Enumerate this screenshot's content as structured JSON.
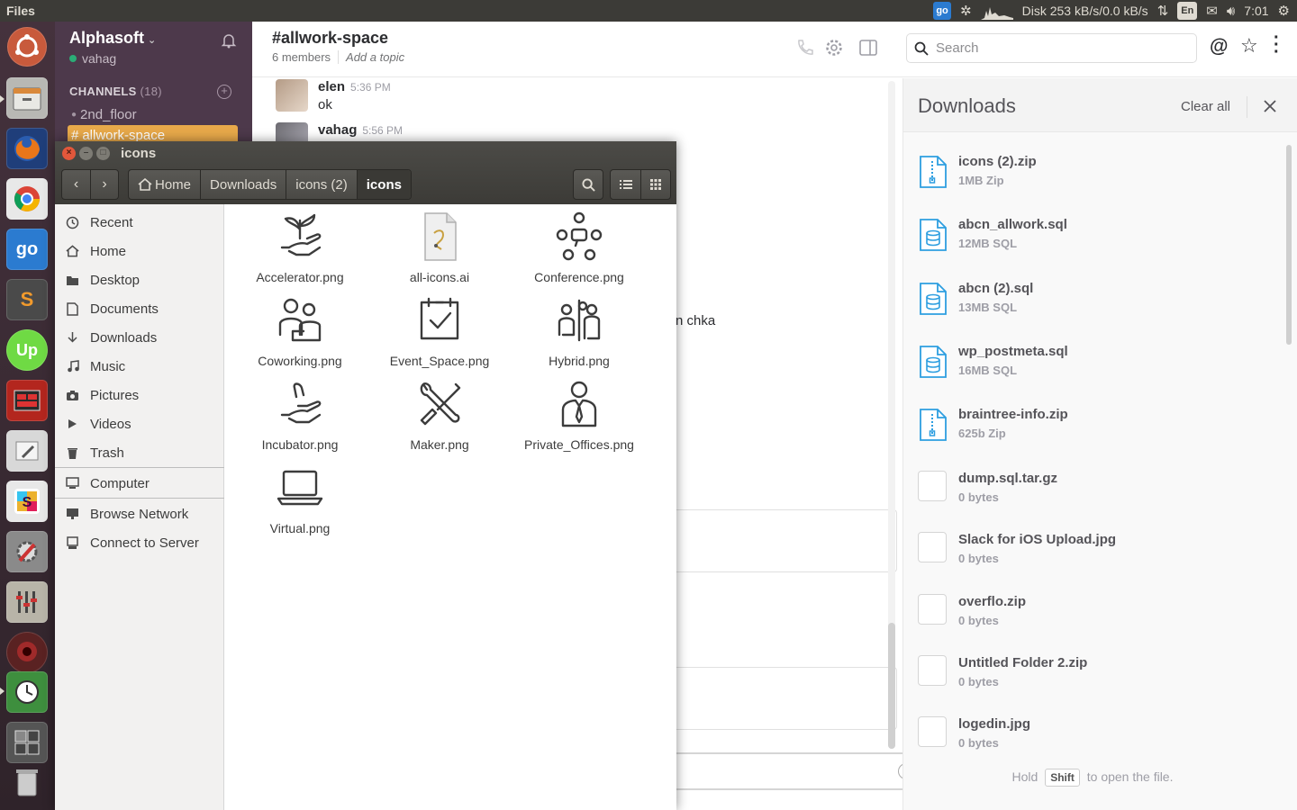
{
  "top_panel": {
    "app_title": "Files",
    "tray": {
      "indicator_label": "go",
      "disk_status": "Disk 253 kB/s/0.0 kB/s",
      "keyboard_layout": "En",
      "clock": "7:01"
    }
  },
  "slack": {
    "team_name": "Alphasoft",
    "user_name": "vahag",
    "channels_heading": "CHANNELS",
    "channels_count": "(18)",
    "channels": [
      {
        "name": "2nd_floor",
        "prefix": "🔒"
      },
      {
        "name": "allwork-space",
        "prefix": "#"
      }
    ],
    "header": {
      "channel_title": "#allwork-space",
      "members": "6 members",
      "topic_placeholder": "Add a topic",
      "search_placeholder": "Search"
    },
    "messages": [
      {
        "author": "elen",
        "time": "5:36 PM",
        "text": "ok"
      },
      {
        "author": "vahag",
        "time": "5:56 PM",
        "text": ""
      }
    ],
    "partial_message_text": "n chka",
    "downloads": {
      "title": "Downloads",
      "clear_all": "Clear all",
      "items": [
        {
          "name": "icons (2).zip",
          "size": "1MB Zip",
          "kind": "zip"
        },
        {
          "name": "abcn_allwork.sql",
          "size": "12MB SQL",
          "kind": "sql"
        },
        {
          "name": "abcn (2).sql",
          "size": "13MB SQL",
          "kind": "sql"
        },
        {
          "name": "wp_postmeta.sql",
          "size": "16MB SQL",
          "kind": "sql"
        },
        {
          "name": "braintree-info.zip",
          "size": "625b Zip",
          "kind": "zip"
        },
        {
          "name": "dump.sql.tar.gz",
          "size": "0 bytes",
          "kind": "blank"
        },
        {
          "name": "Slack for iOS Upload.jpg",
          "size": "0 bytes",
          "kind": "blank"
        },
        {
          "name": "overflo.zip",
          "size": "0 bytes",
          "kind": "blank"
        },
        {
          "name": "Untitled Folder 2.zip",
          "size": "0 bytes",
          "kind": "blank"
        },
        {
          "name": "logedin.jpg",
          "size": "0 bytes",
          "kind": "blank"
        }
      ],
      "hint_before": "Hold",
      "hint_key": "Shift",
      "hint_after": "to open the file."
    }
  },
  "files_window": {
    "title": "icons",
    "breadcrumbs": [
      "Home",
      "Downloads",
      "icons (2)",
      "icons"
    ],
    "places": [
      {
        "label": "Recent",
        "icon": "clock-icon"
      },
      {
        "label": "Home",
        "icon": "home-icon"
      },
      {
        "label": "Desktop",
        "icon": "folder-icon"
      },
      {
        "label": "Documents",
        "icon": "document-icon"
      },
      {
        "label": "Downloads",
        "icon": "download-icon"
      },
      {
        "label": "Music",
        "icon": "music-icon"
      },
      {
        "label": "Pictures",
        "icon": "camera-icon"
      },
      {
        "label": "Videos",
        "icon": "video-icon"
      },
      {
        "label": "Trash",
        "icon": "trash-icon"
      }
    ],
    "devices": [
      {
        "label": "Computer",
        "icon": "computer-icon"
      }
    ],
    "network": [
      {
        "label": "Browse Network",
        "icon": "network-icon"
      },
      {
        "label": "Connect to Server",
        "icon": "server-icon"
      }
    ],
    "files": [
      {
        "name": "Accelerator.png",
        "icon": "plant-hand-icon"
      },
      {
        "name": "all-icons.ai",
        "icon": "illustrator-file-icon"
      },
      {
        "name": "Conference.png",
        "icon": "conference-icon"
      },
      {
        "name": "Coworking.png",
        "icon": "coworking-icon"
      },
      {
        "name": "Event_Space.png",
        "icon": "calendar-check-icon"
      },
      {
        "name": "Hybrid.png",
        "icon": "hybrid-icon"
      },
      {
        "name": "Incubator.png",
        "icon": "hand-icon"
      },
      {
        "name": "Maker.png",
        "icon": "tools-icon"
      },
      {
        "name": "Private_Offices.png",
        "icon": "businessman-icon"
      },
      {
        "name": "Virtual.png",
        "icon": "laptop-icon"
      }
    ]
  },
  "launcher": {
    "items": [
      "dash-icon",
      "files-icon",
      "firefox-icon",
      "chrome-icon",
      "go-icon",
      "sublime-icon",
      "upwork-icon",
      "workspace-icon",
      "system-tools-icon",
      "slack-icon",
      "settings-icon",
      "mixer-icon",
      "webcam-icon",
      "clock-app-icon",
      "workspaces-switcher-icon",
      "trash-launcher-icon"
    ]
  }
}
